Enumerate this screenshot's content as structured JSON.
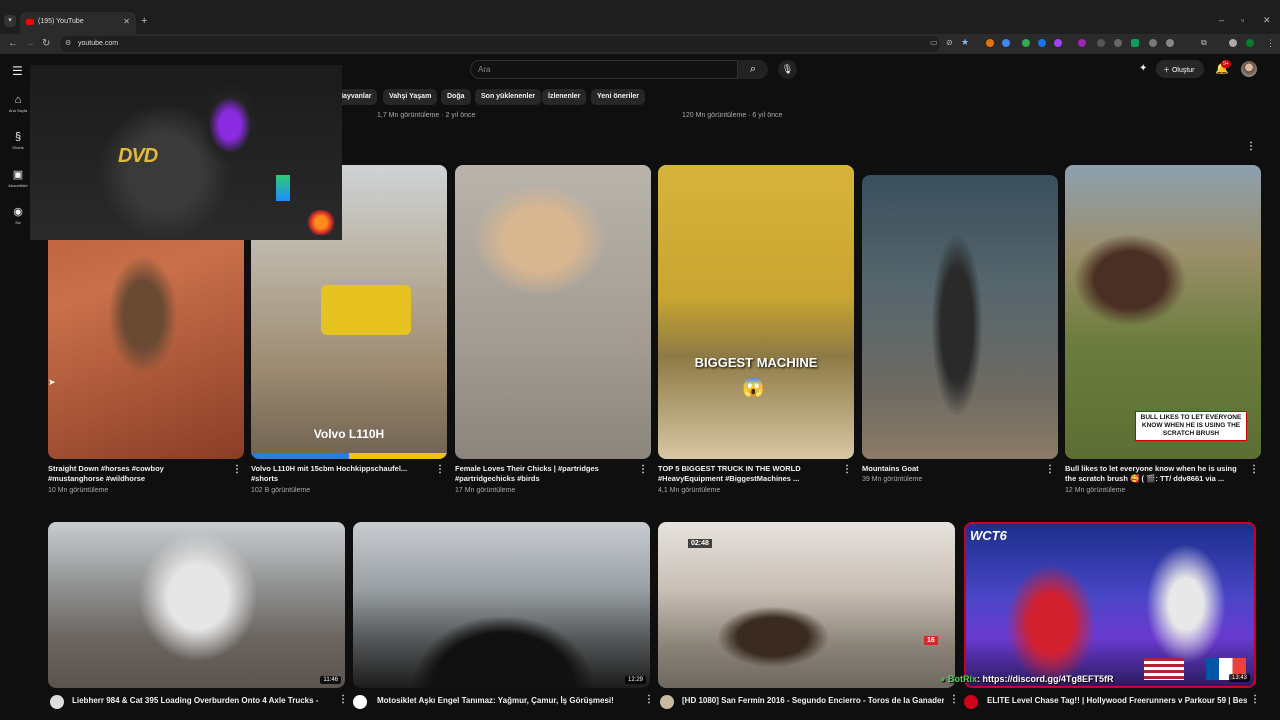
{
  "browser": {
    "tab_title": "(195) YouTube",
    "url": "youtube.com"
  },
  "header": {
    "search_placeholder": "Ara",
    "create_label": "Oluştur",
    "notification_count": "9+"
  },
  "sidebar": [
    {
      "label": "Ana Sayfa",
      "icon": "home-icon"
    },
    {
      "label": "Shorts",
      "icon": "shorts-icon"
    },
    {
      "label": "Abonelikler",
      "icon": "subscriptions-icon"
    },
    {
      "label": "Siz",
      "icon": "you-icon"
    }
  ],
  "chips": [
    "Hayvanlar",
    "Vahşi Yaşam",
    "Doğa",
    "Son yüklenenler",
    "İzlenenler",
    "Yeni öneriler"
  ],
  "previous_meta": [
    "1,7 Mn görüntüleme · 2 yıl önce",
    "120 Mn görüntüleme · 6 yıl önce"
  ],
  "shorts": [
    {
      "title": "Straight Down #horses #cowboy #mustanghorse #wildhorse",
      "views": "10 Mn görüntüleme"
    },
    {
      "title": "Volvo L110H mit 15cbm Hochkippschaufel... #shorts",
      "views": "102 B görüntüleme",
      "overlay": "Volvo L110H"
    },
    {
      "title": "Female Loves Their Chicks | #partridges #partridgechicks #birds",
      "views": "17 Mn görüntüleme"
    },
    {
      "title": "TOP 5 BIGGEST TRUCK IN THE WORLD #HeavyEquipment #BiggestMachines ...",
      "views": "4,1 Mn görüntüleme",
      "overlay": "BIGGEST MACHINE"
    },
    {
      "title": "Mountains Goat",
      "views": "39 Mn görüntüleme"
    },
    {
      "title": "Bull likes to let everyone know when he is using the scratch brush 🥰 ( 🎬: TT/ ddv8661 via ...",
      "views": "12 Mn görüntüleme",
      "overlay": "BULL LIKES TO LET EVERYONE KNOW WHEN HE IS USING THE SCRATCH BRUSH"
    }
  ],
  "videos": [
    {
      "title": "Liebherr 984 & Cat 395 Loading Overburden Onto 4 Axle Trucks -",
      "duration": "11:46"
    },
    {
      "title": "Motosiklet Aşkı Engel Tanımaz: Yağmur, Çamur, İş Görüşmesi!",
      "duration": "12:29"
    },
    {
      "title": "[HD 1080] San Fermín 2016 - Segundo Encierro - Toros de la Ganadería",
      "duration": "",
      "overlay_time": "02:48",
      "badge": "16"
    },
    {
      "title": "ELITE Level Chase Tag!! | Hollywood Freerunners v Parkour 59 | Best of",
      "duration": "13:43",
      "brand": "WCT6"
    }
  ],
  "stream_overlay": {
    "bot_name": "BotRix",
    "message": ": https://discord.gg/4Tg8EFT5fR",
    "cam_logo": "DVD"
  },
  "colors": {
    "background": "#0f0f0f",
    "chip": "#272727",
    "accent": "#ff0000"
  }
}
